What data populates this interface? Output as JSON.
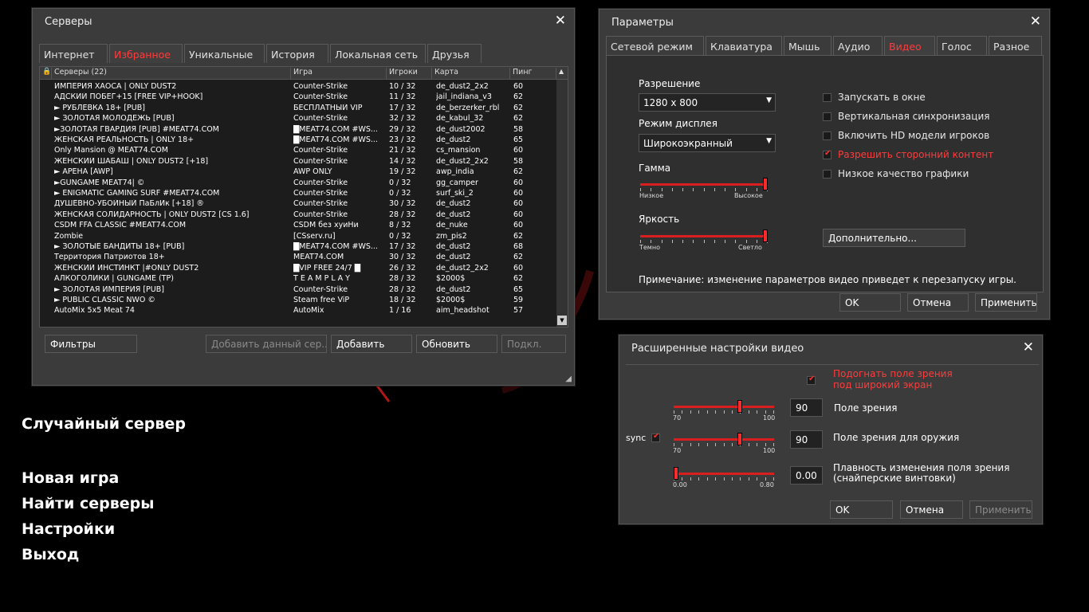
{
  "main_menu": {
    "random_server": "Случайный сервер",
    "new_game": "Новая игра",
    "find_servers": "Найти серверы",
    "settings": "Настройки",
    "exit": "Выход"
  },
  "servers_window": {
    "title": "Серверы",
    "tabs": [
      "Интернет",
      "Избранное",
      "Уникальные",
      "История",
      "Локальная сеть",
      "Друзья"
    ],
    "active_tab": "Избранное",
    "columns": {
      "servers": "Серверы (22)",
      "game": "Игра",
      "players": "Игроки",
      "map": "Карта",
      "ping": "Пинг"
    },
    "rows": [
      {
        "name": "ИМПЕРИЯ ХАОСА | ONLY DUST2",
        "game": "Counter-Strike",
        "players": "10 / 32",
        "map": "de_dust2_2x2",
        "ping": "60"
      },
      {
        "name": "АДСКИЙ ПОБЕГ+15 [FREE VIP+HOOK]",
        "game": "Counter-Strike",
        "players": "11 / 32",
        "map": "jail_indiana_v3",
        "ping": "62"
      },
      {
        "name": "  ► РУБЛЁВКА 18+ [PUB]",
        "game": "БЕСПЛАТНЫЙ VIP",
        "players": "17 / 32",
        "map": "de_berzerker_rbl",
        "ping": "62"
      },
      {
        "name": "  ► ЗОЛОТАЯ МОЛОДЁЖЬ [PUB]",
        "game": "Counter-Strike",
        "players": "32 / 32",
        "map": "de_kabul_32",
        "ping": "62"
      },
      {
        "name": "►ЗОЛОТАЯ ГВАРДИЯ [PUB] #MEAT74.COM",
        "game": "█MEAT74.COM #WS...",
        "players": "29 / 32",
        "map": "de_dust2002",
        "ping": "58"
      },
      {
        "name": "ЖЕНСКАЯ РЕАЛЬНОСТЬ | ONLY 18+",
        "game": "█MEAT74.COM #WS...",
        "players": "23 / 32",
        "map": "de_dust2",
        "ping": "65"
      },
      {
        "name": "Only Mansion @ MEAT74.COM",
        "game": "Counter-Strike",
        "players": "21 / 32",
        "map": "cs_mansion",
        "ping": "60"
      },
      {
        "name": "ЖЕНСКИЙ ШАБАШ | ONLY DUST2 [+18]",
        "game": "Counter-Strike",
        "players": "14 / 32",
        "map": "de_dust2_2x2",
        "ping": "58"
      },
      {
        "name": "►  АРЕНА [AWP]",
        "game": "AWP ONLY",
        "players": "19 / 32",
        "map": "awp_india",
        "ping": "62"
      },
      {
        "name": "►GUNGAME MEAT74| ©",
        "game": "Counter-Strike",
        "players": "0 / 32",
        "map": "gg_camper",
        "ping": "60"
      },
      {
        "name": "► ENIGMATIC GAMING SURF #MEAT74.COM",
        "game": "Counter-Strike",
        "players": "0 / 32",
        "map": "surf_ski_2",
        "ping": "60"
      },
      {
        "name": "ДУШЕВНО-УБОЙНЫЙ ПаБлИк [+18] ®",
        "game": "Counter-Strike",
        "players": "30 / 32",
        "map": "de_dust2",
        "ping": "60"
      },
      {
        "name": "ЖЕНСКАЯ СОЛИДАРНОСТЬ | ONLY DUST2 [CS 1.6]",
        "game": "Counter-Strike",
        "players": "28 / 32",
        "map": "de_dust2",
        "ping": "60"
      },
      {
        "name": " CSDM FFA CLASSIC #MEAT74.COM",
        "game": "CSDM без хуиНи",
        "players": "8 / 32",
        "map": "de_nuke",
        "ping": "60"
      },
      {
        "name": "Zombie",
        "game": "[CSserv.ru]",
        "players": "0 / 32",
        "map": "zm_pis2",
        "ping": "62"
      },
      {
        "name": "► ЗОЛОТЫЕ БАНДИТЫ 18+ [PUB]",
        "game": "█MEAT74.COM #WS...",
        "players": "17 / 32",
        "map": "de_dust2",
        "ping": "68"
      },
      {
        "name": "Территория Патриотов 18+",
        "game": "MEAT74.COM",
        "players": "30 / 32",
        "map": "de_dust2",
        "ping": "62"
      },
      {
        "name": "ЖЕНСКИЙ ИНСТИНКТ |#ONLY DUST2",
        "game": "█VIP FREE 24/7 █",
        "players": "26 / 32",
        "map": "de_dust2_2x2",
        "ping": "60"
      },
      {
        "name": "АЛКОГОЛИКИ | GUNGAME (TP)",
        "game": "T E A M P L A Y",
        "players": "28 / 32",
        "map": "$2000$",
        "ping": "62"
      },
      {
        "name": "  ►  ЗОЛОТАЯ ИМПЕРИЯ [PUB]",
        "game": "Counter-Strike",
        "players": "28 / 32",
        "map": "de_dust2",
        "ping": "65"
      },
      {
        "name": "► PUBLIC CLASSIC NWO ©",
        "game": "Steam free ViP",
        "players": "18 / 32",
        "map": "$2000$",
        "ping": "59"
      },
      {
        "name": "AutoMix 5x5 Meat 74",
        "game": "AutoMix",
        "players": "1 / 16",
        "map": "aim_headshot",
        "ping": "57"
      }
    ],
    "buttons": {
      "filters": "Фильтры",
      "add_current": "Добавить данный сер...",
      "add": "Добавить",
      "refresh": "Обновить",
      "connect": "Подкл."
    }
  },
  "options_window": {
    "title": "Параметры",
    "tabs": [
      "Сетевой режим",
      "Клавиатура",
      "Мышь",
      "Аудио",
      "Видео",
      "Голос",
      "Разное"
    ],
    "active_tab": "Видео",
    "resolution_label": "Разрешение",
    "resolution_value": "1280 x 800",
    "display_mode_label": "Режим дисплея",
    "display_mode_value": "Широкоэкранный",
    "gamma_label": "Гамма",
    "gamma_low": "Низкое",
    "gamma_high": "Высокое",
    "gamma_level": 1.0,
    "brightness_label": "Яркость",
    "brightness_low": "Темно",
    "brightness_high": "Светло",
    "brightness_level": 1.0,
    "checkboxes": [
      {
        "label": "Запускать в окне",
        "checked": false
      },
      {
        "label": "Вертикальная синхронизация",
        "checked": false
      },
      {
        "label": "Включить HD модели игроков",
        "checked": false
      },
      {
        "label": "Разрешить сторонний контент",
        "checked": true
      },
      {
        "label": "Низкое качество графики",
        "checked": false
      }
    ],
    "advanced_button": "Дополнительно...",
    "note": "Примечание: изменение параметров видео приведет к перезапуску игры.",
    "ok": "OK",
    "cancel": "Отмена",
    "apply": "Применить"
  },
  "advanced_video_window": {
    "title": "Расширенные настройки видео",
    "fit_fov_label_1": "Подогнать поле зрения",
    "fit_fov_label_2": "под широкий экран",
    "fit_fov_checked": true,
    "fov_label": "Поле зрения",
    "fov_value": "90",
    "fov_min": "70",
    "fov_max": "100",
    "weapon_fov_label": "Поле зрения для оружия",
    "weapon_fov_value": "90",
    "weapon_fov_min": "70",
    "weapon_fov_max": "100",
    "sync_label": "sync",
    "sync_checked": true,
    "smooth_label_1": "Плавность изменения поля зрения",
    "smooth_label_2": "(снайперские винтовки)",
    "smooth_value": "0.00",
    "smooth_min": "0.00",
    "smooth_max": "0.80",
    "ok": "OK",
    "cancel": "Отмена",
    "apply": "Применить"
  },
  "colors": {
    "accent": "#ff3b3b",
    "window_bg": "#3b3b3b",
    "list_bg": "#1c1c1c"
  }
}
